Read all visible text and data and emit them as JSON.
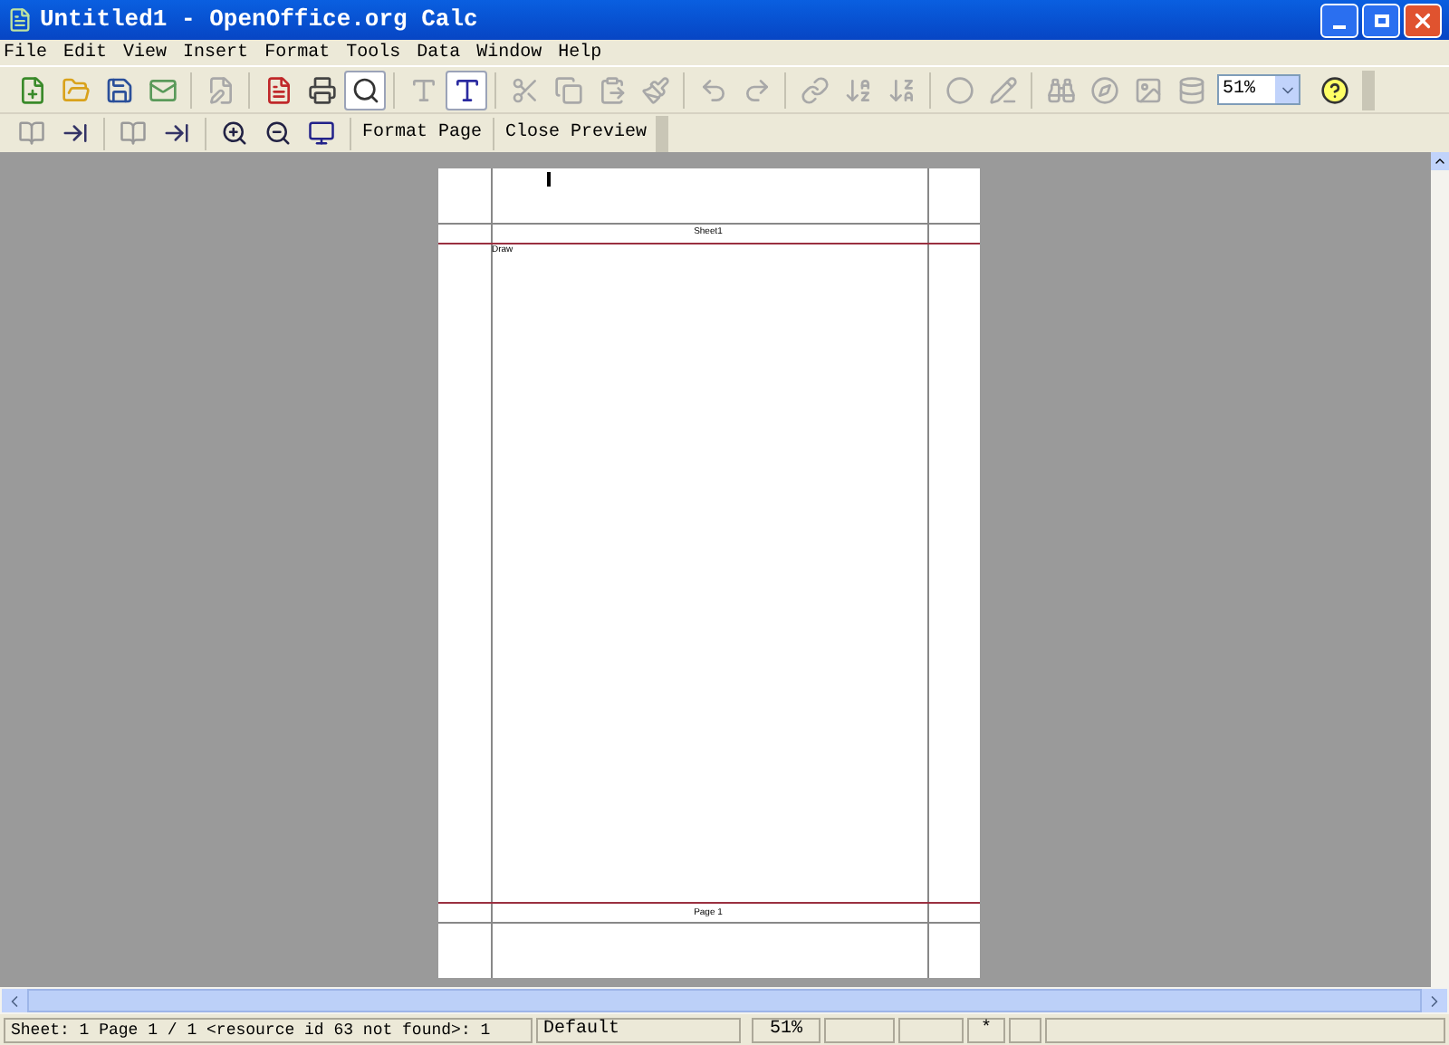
{
  "window": {
    "title": "Untitled1 - OpenOffice.org Calc"
  },
  "menu": [
    "File",
    "Edit",
    "View",
    "Insert",
    "Format",
    "Tools",
    "Data",
    "Window",
    "Help"
  ],
  "standard_toolbar": [
    {
      "kind": "new",
      "disabled": false,
      "pressed": false
    },
    {
      "kind": "open",
      "disabled": false,
      "pressed": false
    },
    {
      "kind": "save",
      "disabled": false,
      "pressed": false
    },
    {
      "kind": "mail",
      "disabled": false,
      "pressed": false
    },
    {
      "kind": "sep"
    },
    {
      "kind": "edit",
      "disabled": true,
      "pressed": false
    },
    {
      "kind": "sep"
    },
    {
      "kind": "pdf",
      "disabled": false,
      "pressed": false
    },
    {
      "kind": "print",
      "disabled": false,
      "pressed": false
    },
    {
      "kind": "preview",
      "disabled": false,
      "pressed": true
    },
    {
      "kind": "sep"
    },
    {
      "kind": "spellcheck",
      "disabled": true,
      "pressed": false
    },
    {
      "kind": "autospell",
      "disabled": false,
      "pressed": true
    },
    {
      "kind": "sep"
    },
    {
      "kind": "cut",
      "disabled": true,
      "pressed": false
    },
    {
      "kind": "copy",
      "disabled": true,
      "pressed": false
    },
    {
      "kind": "paste",
      "disabled": true,
      "pressed": false
    },
    {
      "kind": "brush",
      "disabled": true,
      "pressed": false
    },
    {
      "kind": "sep"
    },
    {
      "kind": "undo",
      "disabled": true,
      "pressed": false
    },
    {
      "kind": "redo",
      "disabled": true,
      "pressed": false
    },
    {
      "kind": "sep"
    },
    {
      "kind": "link",
      "disabled": true,
      "pressed": false
    },
    {
      "kind": "sort_asc",
      "disabled": true,
      "pressed": false
    },
    {
      "kind": "sort_desc",
      "disabled": true,
      "pressed": false
    },
    {
      "kind": "sep"
    },
    {
      "kind": "chart",
      "disabled": true,
      "pressed": false
    },
    {
      "kind": "check",
      "disabled": true,
      "pressed": false
    },
    {
      "kind": "sep"
    },
    {
      "kind": "find",
      "disabled": true,
      "pressed": false
    },
    {
      "kind": "navigator",
      "disabled": true,
      "pressed": false
    },
    {
      "kind": "gallery",
      "disabled": true,
      "pressed": false
    },
    {
      "kind": "datasource",
      "disabled": true,
      "pressed": false
    }
  ],
  "zoom_field": {
    "value": "51%"
  },
  "preview_toolbar": {
    "buttons": [
      "Format Page",
      "Close Preview"
    ]
  },
  "page": {
    "header": "Sheet1",
    "cell": "Draw",
    "footer": "Page 1"
  },
  "status_bar": {
    "info": "Sheet: 1  Page 1 / 1  <resource id 63 not found>: 1",
    "style": "Default",
    "zoom": "51%",
    "modified": "*"
  }
}
